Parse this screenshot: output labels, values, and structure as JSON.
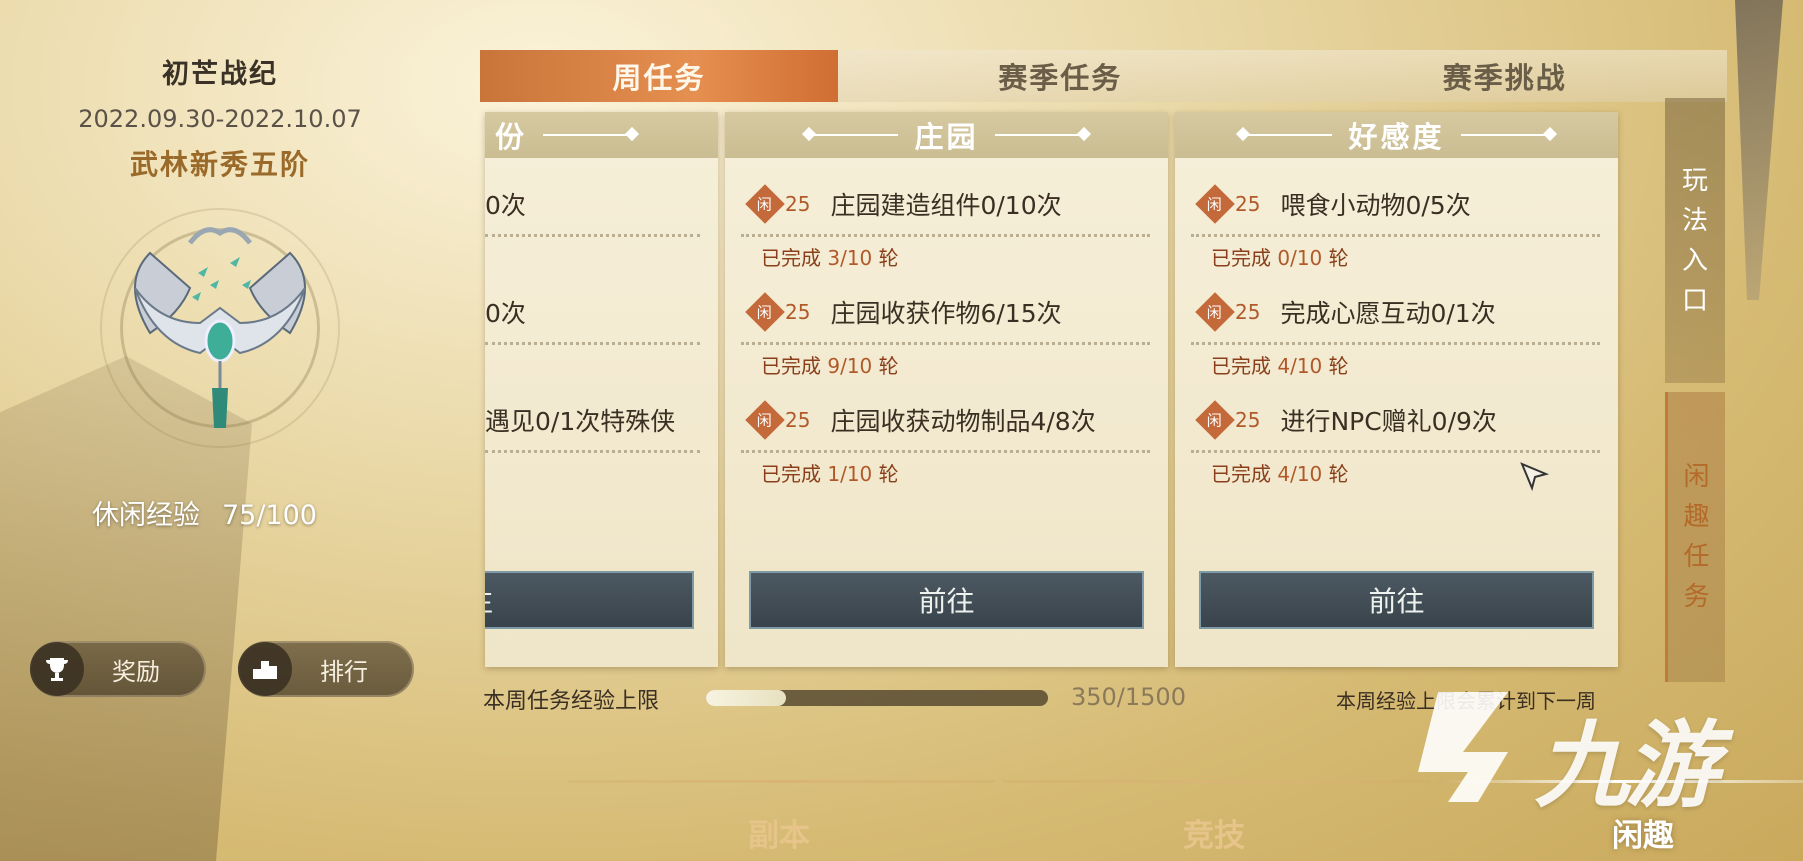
{
  "left": {
    "season_name": "初芒战纪",
    "date_range": "2022.09.30-2022.10.07",
    "rank": "武林新秀五阶",
    "exp_label": "休闲经验",
    "exp_value": "75/100",
    "buttons": {
      "reward": "奖励",
      "rank": "排行"
    }
  },
  "tabs": [
    {
      "label": "周任务",
      "active": true
    },
    {
      "label": "赛季任务",
      "active": false
    },
    {
      "label": "赛季挑战",
      "active": false
    }
  ],
  "cards": [
    {
      "header": "份",
      "tasks": [
        {
          "title": "0次"
        },
        {
          "title": "0次"
        },
        {
          "title": "遇见0/1次特殊侠"
        }
      ],
      "button": "前往"
    },
    {
      "header": "庄园",
      "tasks": [
        {
          "badge_char": "闲",
          "points": "25",
          "title": "庄园建造组件0/10次",
          "done_label": "已完成",
          "done_value": "3/10",
          "done_unit": "轮"
        },
        {
          "badge_char": "闲",
          "points": "25",
          "title": "庄园收获作物6/15次",
          "done_label": "已完成",
          "done_value": "9/10",
          "done_unit": "轮"
        },
        {
          "badge_char": "闲",
          "points": "25",
          "title": "庄园收获动物制品4/8次",
          "done_label": "已完成",
          "done_value": "1/10",
          "done_unit": "轮"
        }
      ],
      "button": "前往"
    },
    {
      "header": "好感度",
      "tasks": [
        {
          "badge_char": "闲",
          "points": "25",
          "title": "喂食小动物0/5次",
          "done_label": "已完成",
          "done_value": "0/10",
          "done_unit": "轮"
        },
        {
          "badge_char": "闲",
          "points": "25",
          "title": "完成心愿互动0/1次",
          "done_label": "已完成",
          "done_value": "4/10",
          "done_unit": "轮"
        },
        {
          "badge_char": "闲",
          "points": "25",
          "title": "进行NPC赠礼0/9次",
          "done_label": "已完成",
          "done_value": "4/10",
          "done_unit": "轮"
        }
      ],
      "button": "前往"
    }
  ],
  "weekly_cap": {
    "label": "本周任务经验上限",
    "value": "350/1500",
    "progress": 0.233,
    "note": "本周经验上限会累计到下一周"
  },
  "side_tabs": [
    {
      "label": "玩法入口",
      "chars": [
        "玩",
        "法",
        "入",
        "口"
      ]
    },
    {
      "label": "闲趣任务",
      "chars": [
        "闲",
        "趣",
        "任",
        "务"
      ]
    }
  ],
  "bottom_nav": [
    {
      "label": "副本"
    },
    {
      "label": "竞技"
    },
    {
      "label": "闲趣",
      "active": true
    }
  ],
  "watermark": "九游",
  "colors": {
    "accent_orange": "#e58f50",
    "button_slate": "#38434b",
    "done_red": "#8a3f1a"
  }
}
